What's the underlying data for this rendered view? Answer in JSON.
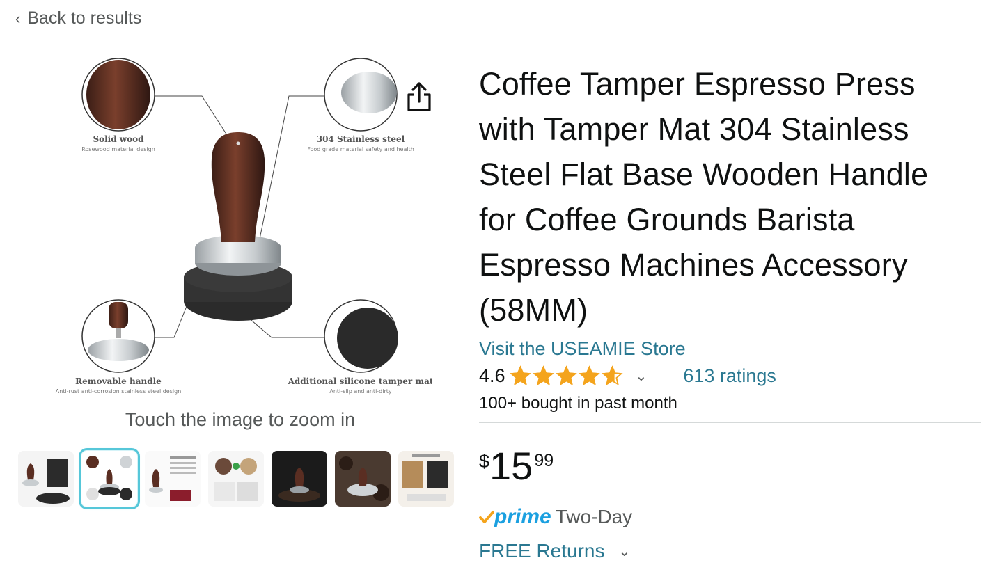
{
  "nav": {
    "back_label": "Back to results"
  },
  "product": {
    "title": "Coffee Tamper Espresso Press with Tamper Mat 304 Stainless Steel Flat Base Wooden Handle for Coffee Grounds Barista Espresso Machines Accessory (58MM)",
    "store_link": "Visit the USEAMIE Store",
    "rating_value": "4.6",
    "rating_stars": 4.6,
    "ratings_count": "613 ratings",
    "bought_text": "100+ bought in past month",
    "price_symbol": "$",
    "price_whole": "15",
    "price_fraction": "99",
    "prime_label": "prime",
    "delivery": "Two-Day",
    "returns": "FREE Returns"
  },
  "gallery": {
    "zoom_hint": "Touch the image to zoom in",
    "callouts": {
      "solid_wood_title": "Solid wood",
      "solid_wood_sub": "Rosewood material design",
      "steel_title": "304 Stainless steel",
      "steel_sub": "Food grade material safety and health",
      "handle_title": "Removable handle",
      "handle_sub": "Anti-rust anti-corrosion stainless steel design",
      "mat_title": "Additional silicone tamper mat",
      "mat_sub": "Anti-slip and anti-dirty"
    },
    "thumbnail_count": 7,
    "selected_thumbnail": 2
  },
  "colors": {
    "link": "#2a7891",
    "star": "#f4a41d",
    "prime": "#1ba0e0",
    "wood": "#5a2e22",
    "selected_outline": "#56c7d9"
  },
  "icons": [
    "back-chevron-icon",
    "share-icon",
    "star-icon",
    "chevron-down-icon",
    "prime-check-icon"
  ]
}
